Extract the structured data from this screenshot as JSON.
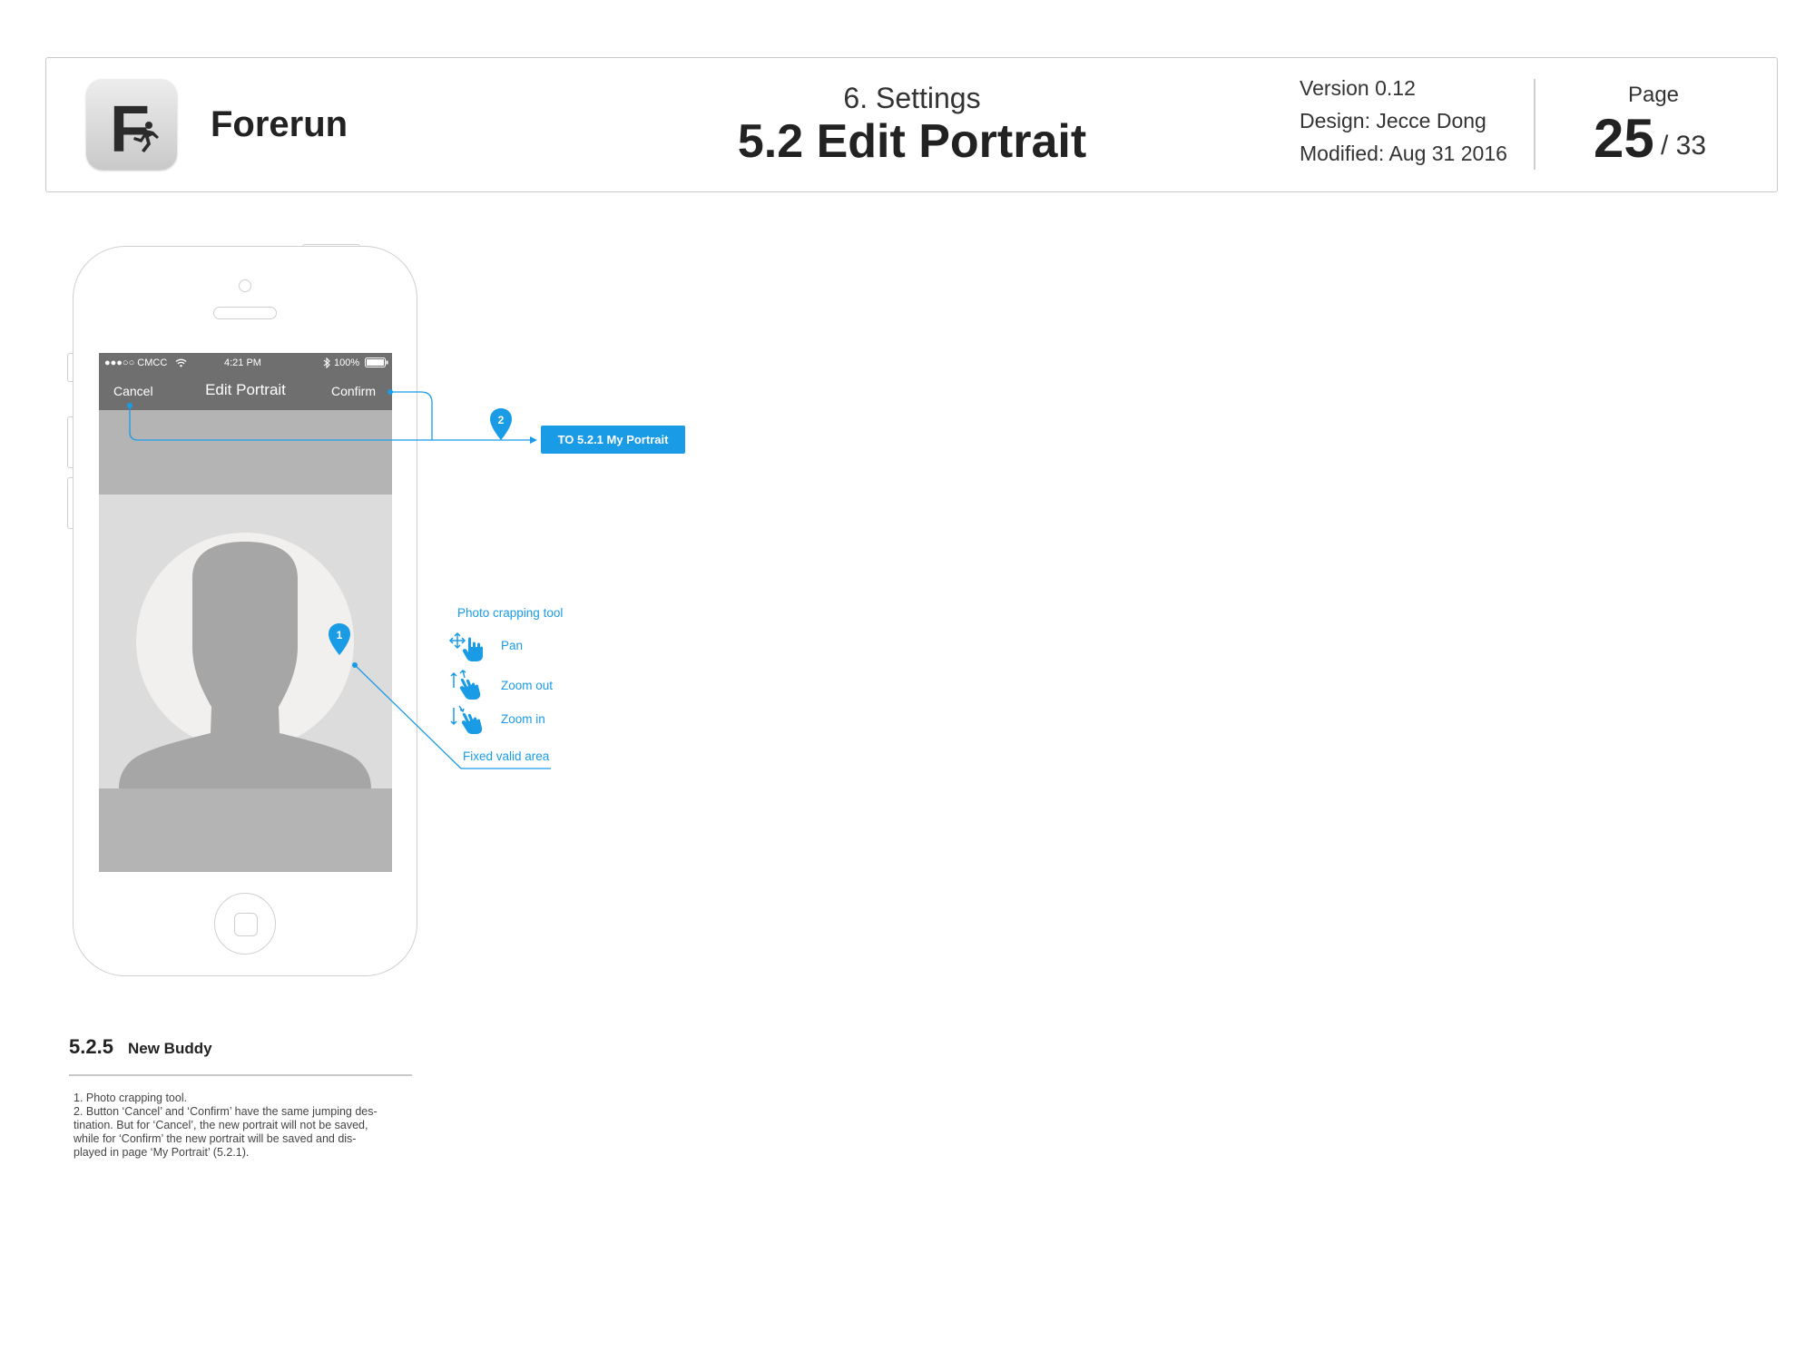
{
  "header": {
    "app_name": "Forerun",
    "logo_letter": "F",
    "section": "6. Settings",
    "title": "5.2 Edit Portrait",
    "version": "Version 0.12",
    "design": "Design: Jecce Dong",
    "modified": "Modified: Aug 31 2016",
    "page_label": "Page",
    "page_current": "25",
    "page_total": "/ 33"
  },
  "phone": {
    "status_bar": {
      "carrier": "●●●○○ CMCC",
      "time": "4:21 PM",
      "battery": "100%"
    },
    "nav": {
      "left": "Cancel",
      "title": "Edit Portrait",
      "right": "Confirm"
    }
  },
  "annotations": {
    "link_target": "TO 5.2.1 My Portrait",
    "marker_1": "1",
    "marker_2": "2",
    "tool_title": "Photo crapping tool",
    "gestures": [
      "Pan",
      "Zoom out",
      "Zoom in"
    ],
    "valid_area": "Fixed valid area"
  },
  "notes": {
    "number": "5.2.5",
    "title": "New Buddy",
    "lines": [
      "1. Photo crapping tool.",
      "2. Button ‘Cancel’ and ‘Confirm’ have the same jumping des-",
      "tination. But for ‘Cancel’, the new portrait will not be saved,",
      "while for ‘Confirm’ the new portrait will be saved and dis-",
      "played in page ‘My Portrait’ (5.2.1)."
    ]
  },
  "colors": {
    "accent": "#1a9be6",
    "nav_bar": "#6f6f6f",
    "mask": "#b4b4b4",
    "silhouette": "#a6a6a6"
  }
}
